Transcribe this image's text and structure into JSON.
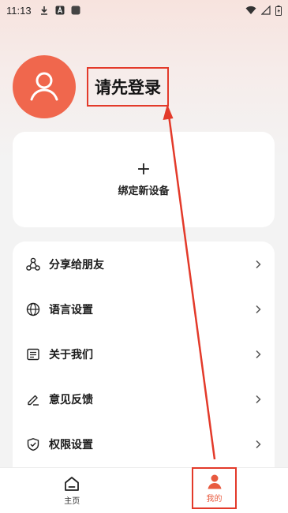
{
  "status_bar": {
    "time": "11:13",
    "left_icons": [
      "download-icon",
      "a-box-icon",
      "square-icon"
    ],
    "right_icons": [
      "wifi-icon",
      "signal-icon",
      "battery-icon"
    ]
  },
  "profile": {
    "login_prompt": "请先登录"
  },
  "bind_device": {
    "plus": "+",
    "label": "绑定新设备"
  },
  "menu": {
    "items": [
      {
        "icon": "share-icon",
        "label": "分享给朋友"
      },
      {
        "icon": "globe-icon",
        "label": "语言设置"
      },
      {
        "icon": "document-icon",
        "label": "关于我们"
      },
      {
        "icon": "edit-icon",
        "label": "意见反馈"
      },
      {
        "icon": "shield-check-icon",
        "label": "权限设置"
      }
    ]
  },
  "tabbar": {
    "home_label": "主页",
    "me_label": "我的"
  },
  "colors": {
    "accent": "#f0674d",
    "annotation_red": "#e33a2a"
  }
}
